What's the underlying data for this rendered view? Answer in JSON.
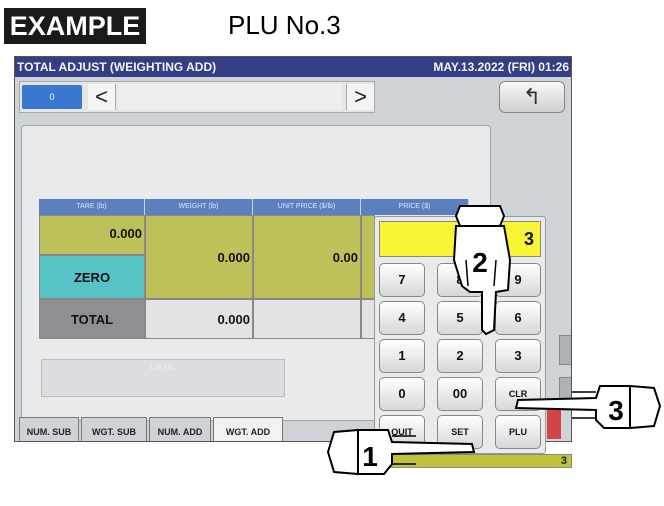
{
  "header": {
    "example_label": "EXAMPLE",
    "title": "PLU No.3"
  },
  "screen": {
    "title": "TOTAL ADJUST (WEIGHTING ADD)",
    "datetime": "MAY.13.2022 (FRI)  01:26",
    "nav": {
      "id_value": "0",
      "prev_glyph": "<",
      "next_glyph": ">",
      "back_glyph": "↰"
    },
    "table": {
      "headers": [
        "TARE (lb)",
        "WEIGHT (lb)",
        "UNIT PRICE ($/lb)",
        "PRICE ($)"
      ],
      "tare_value": "0.000",
      "weight_value": "0.000",
      "unit_price_value": "0.00",
      "total_weight": "0.000",
      "zero_label": "ZERO",
      "total_label": "TOTAL"
    },
    "lot_label": "Lot No.",
    "tabs": [
      "NUM. SUB",
      "WGT. SUB",
      "NUM. ADD",
      "WGT. ADD"
    ],
    "active_tab": "WGT. ADD"
  },
  "keypad": {
    "display_value": "3",
    "keys": {
      "k7": "7",
      "k8": "8",
      "k9": "9",
      "k4": "4",
      "k5": "5",
      "k6": "6",
      "k1": "1",
      "k2": "2",
      "k3": "3",
      "k0": "0",
      "k00": "00",
      "clr": "CLR",
      "quit": "QUIT",
      "set": "SET",
      "plu": "PLU"
    },
    "status_value": "3"
  },
  "steps": {
    "step1": "1",
    "step2": "2",
    "step3": "3"
  },
  "colors": {
    "titlebar": "#343e86",
    "display": "#f7f536",
    "olive": "#bec159",
    "teal": "#58c3c7"
  }
}
